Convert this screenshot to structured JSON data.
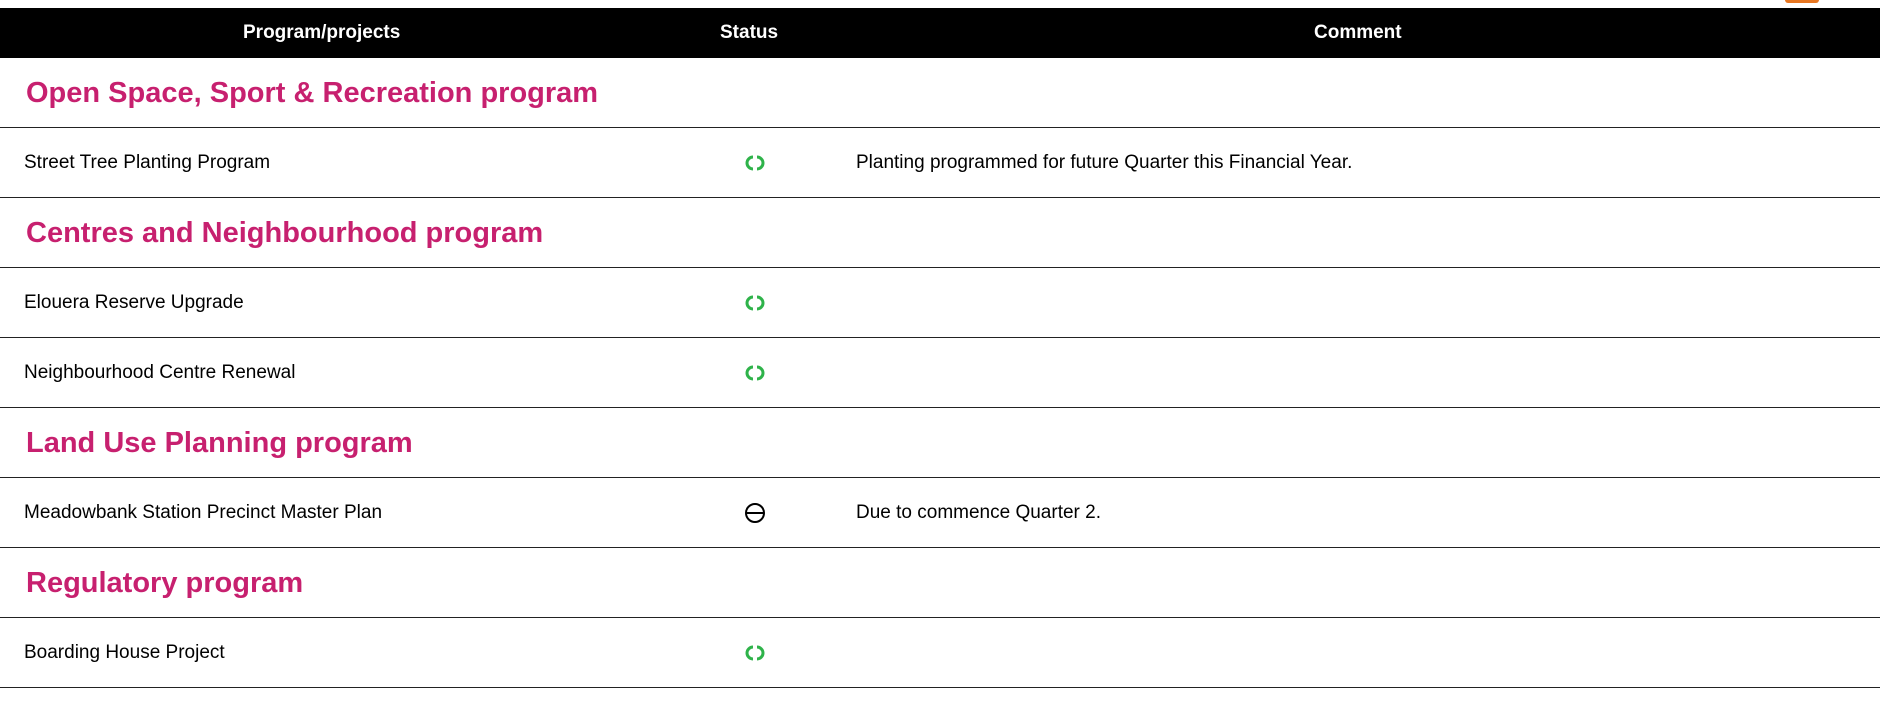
{
  "colors": {
    "header_bg": "#000000",
    "section_title": "#c7206f",
    "on_track": "#2fb34a",
    "not_started": "#000000"
  },
  "table": {
    "headers": {
      "program": "Program/projects",
      "status": "Status",
      "comment": "Comment"
    },
    "rows": [
      {
        "type": "section",
        "title": "Open Space, Sport & Recreation program"
      },
      {
        "type": "item",
        "name": "Street Tree Planting Program",
        "status": "on-track-icon",
        "comment": "Planting programmed for future Quarter this Financial Year."
      },
      {
        "type": "section",
        "title": "Centres and Neighbourhood program"
      },
      {
        "type": "item",
        "name": "Elouera Reserve Upgrade",
        "status": "on-track-icon",
        "comment": ""
      },
      {
        "type": "item",
        "name": "Neighbourhood Centre Renewal",
        "status": "on-track-icon",
        "comment": ""
      },
      {
        "type": "section",
        "title": "Land Use Planning program"
      },
      {
        "type": "item",
        "name": "Meadowbank Station Precinct Master Plan",
        "status": "not-started-icon",
        "comment": "Due to commence Quarter 2."
      },
      {
        "type": "section",
        "title": "Regulatory program"
      },
      {
        "type": "item",
        "name": "Boarding House Project",
        "status": "on-track-icon",
        "comment": ""
      }
    ]
  }
}
